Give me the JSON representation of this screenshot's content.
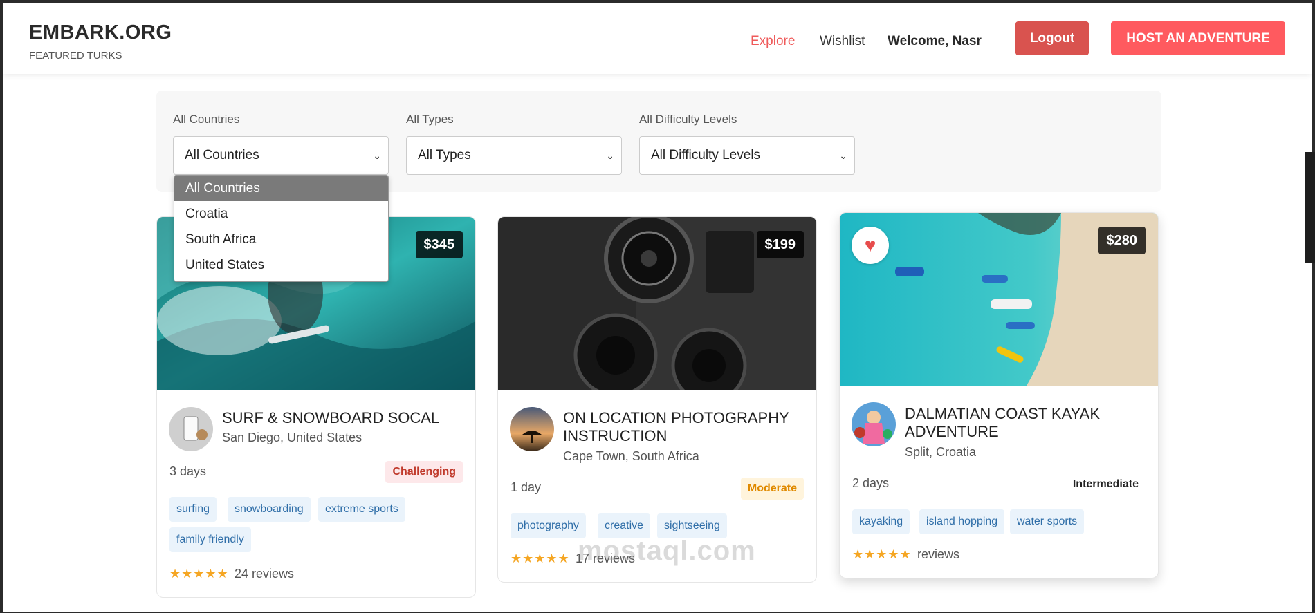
{
  "header": {
    "brand": "EMBARK.ORG",
    "tagline": "FEATURED TURKS",
    "nav": {
      "explore": "Explore",
      "wishlist": "Wishlist",
      "welcome": "Welcome, Nasr"
    },
    "logout_label": "Logout",
    "host_label": "HOST AN ADVENTURE"
  },
  "filters": {
    "country": {
      "label": "All Countries",
      "value": "All Countries"
    },
    "type": {
      "label": "All Types",
      "value": "All Types"
    },
    "difficulty": {
      "label": "All Difficulty Levels",
      "value": "All Difficulty Levels"
    },
    "country_options": [
      "All Countries",
      "Croatia",
      "South Africa",
      "United States"
    ]
  },
  "cards": [
    {
      "price": "$345",
      "title": "SURF & SNOWBOARD SOCAL",
      "location": "San Diego, United States",
      "duration": "3 days",
      "difficulty": "Challenging",
      "tags": [
        "surfing",
        "snowboarding",
        "extreme sports",
        "family friendly"
      ],
      "stars": "★★★★★",
      "reviews": "24 reviews"
    },
    {
      "price": "$199",
      "title": "ON LOCATION PHOTOGRAPHY INSTRUCTION",
      "location": "Cape Town, South Africa",
      "duration": "1 day",
      "difficulty": "Moderate",
      "tags": [
        "photography",
        "creative",
        "sightseeing"
      ],
      "stars": "★★★★★",
      "reviews": "17 reviews"
    },
    {
      "price": "$280",
      "title": "DALMATIAN COAST KAYAK ADVENTURE",
      "location": "Split, Croatia",
      "duration": "2 days",
      "difficulty": "Intermediate",
      "tags": [
        "kayaking",
        "island hopping",
        "water sports"
      ],
      "stars": "★★★★★",
      "reviews": "reviews"
    }
  ],
  "watermark": "mostaql.com",
  "colors": {
    "accent": "#ff5a5f",
    "logout": "#d9534f",
    "star": "#f5a623",
    "tag_bg": "#eaf3fb",
    "tag_text": "#2f6ea8"
  }
}
